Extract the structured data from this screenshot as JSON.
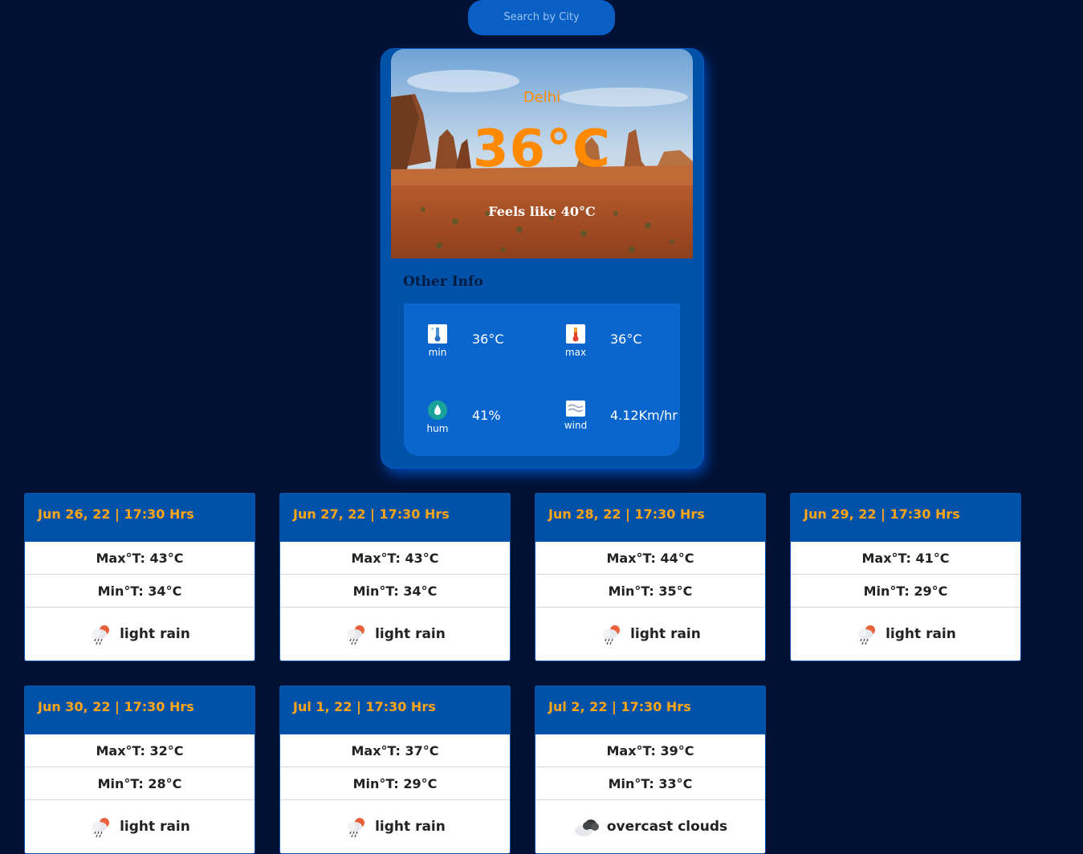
{
  "search": {
    "label": "Search by City"
  },
  "current": {
    "city": "Delhi",
    "temp": "36°C",
    "feels_like": "Feels like 40°C",
    "other_info_title": "Other Info",
    "min_label": "min",
    "min_value": "36°C",
    "max_label": "max",
    "max_value": "36°C",
    "hum_label": "hum",
    "hum_value": "41%",
    "wind_label": "wind",
    "wind_value": "4.12Km/hr"
  },
  "forecast": [
    {
      "date": "Jun 26, 22 | 17:30 Hrs",
      "max": "Max°T: 43°C",
      "min": "Min°T: 34°C",
      "desc": "light rain",
      "icon": "light-rain-icon"
    },
    {
      "date": "Jun 27, 22 | 17:30 Hrs",
      "max": "Max°T: 43°C",
      "min": "Min°T: 34°C",
      "desc": "light rain",
      "icon": "light-rain-icon"
    },
    {
      "date": "Jun 28, 22 | 17:30 Hrs",
      "max": "Max°T: 44°C",
      "min": "Min°T: 35°C",
      "desc": "light rain",
      "icon": "light-rain-icon"
    },
    {
      "date": "Jun 29, 22 | 17:30 Hrs",
      "max": "Max°T: 41°C",
      "min": "Min°T: 29°C",
      "desc": "light rain",
      "icon": "light-rain-icon"
    },
    {
      "date": "Jun 30, 22 | 17:30 Hrs",
      "max": "Max°T: 32°C",
      "min": "Min°T: 28°C",
      "desc": "light rain",
      "icon": "light-rain-icon"
    },
    {
      "date": "Jul 1, 22 | 17:30 Hrs",
      "max": "Max°T: 37°C",
      "min": "Min°T: 29°C",
      "desc": "light rain",
      "icon": "light-rain-icon"
    },
    {
      "date": "Jul 2, 22 | 17:30 Hrs",
      "max": "Max°T: 39°C",
      "min": "Min°T: 33°C",
      "desc": "overcast clouds",
      "icon": "overcast-clouds-icon"
    }
  ],
  "colors": {
    "background": "#001133",
    "card": "#0052a8",
    "accent": "#ff8a00",
    "date": "#ffa51a"
  }
}
